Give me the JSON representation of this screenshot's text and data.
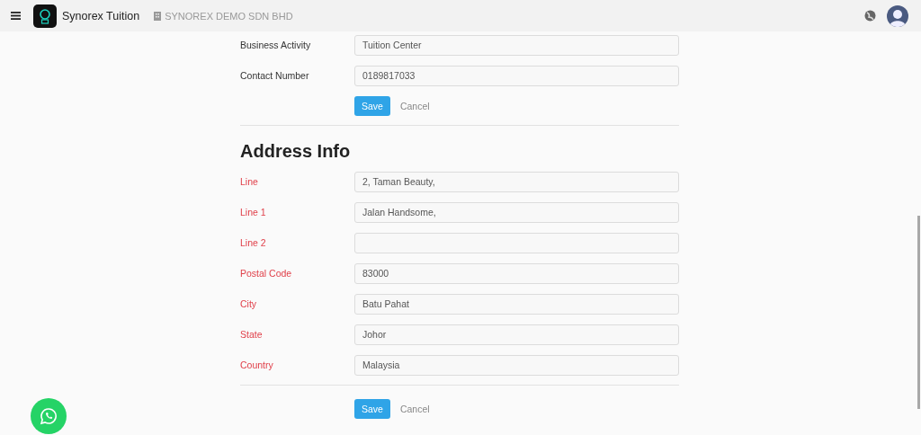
{
  "header": {
    "app_name": "Synorex Tuition",
    "company": "SYNOREX DEMO SDN BHD"
  },
  "business_fields": [
    {
      "label": "Business Activity",
      "value": "Tuition Center",
      "required": false
    },
    {
      "label": "Contact Number",
      "value": "0189817033",
      "required": false
    }
  ],
  "business_actions": {
    "save": "Save",
    "cancel": "Cancel"
  },
  "address_heading": "Address Info",
  "address_fields": [
    {
      "label": "Line",
      "value": "2, Taman Beauty,",
      "required": true
    },
    {
      "label": "Line 1",
      "value": "Jalan Handsome,",
      "required": true
    },
    {
      "label": "Line 2",
      "required": true
    },
    {
      "label": "Postal Code",
      "value": "83000",
      "required": true
    },
    {
      "label": "City",
      "value": "Batu Pahat",
      "required": true
    },
    {
      "label": "State",
      "value": "Johor",
      "required": true
    },
    {
      "label": "Country",
      "value": "Malaysia",
      "required": true
    }
  ],
  "address_actions": {
    "save": "Save",
    "cancel": "Cancel"
  }
}
